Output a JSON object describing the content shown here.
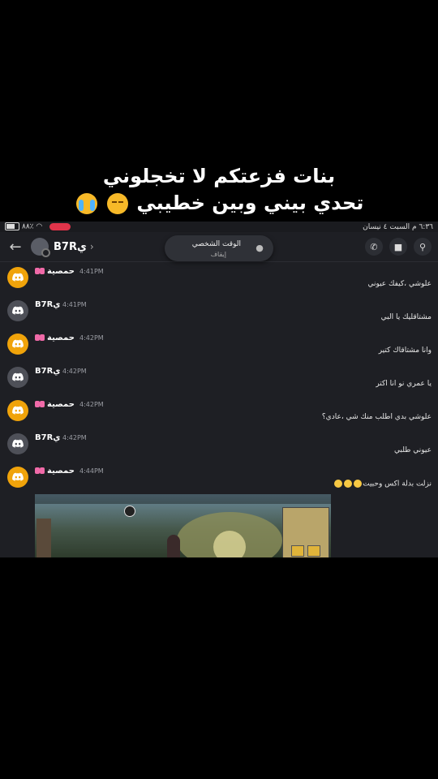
{
  "caption": {
    "line1": "بنات فزعتكم لا تخجلوني",
    "line2": "تحدي بيني وبين خطيبي"
  },
  "status_bar": {
    "time_date": "٦:٣٦ م  السبت ٤ نيسان",
    "battery": "٨٨٪"
  },
  "header": {
    "title": "B7Rي",
    "popup_title": "الوقت الشخصي",
    "popup_subtitle": "إيقاف"
  },
  "icons": {
    "back": "arrow-left-icon",
    "call": "phone-icon",
    "video": "video-icon",
    "search": "search-icon"
  },
  "messages": [
    {
      "author": "حمصية",
      "time": "4:41PM",
      "text": "علوشي ،كيفك عيوني",
      "avatar": "gold",
      "bow": true
    },
    {
      "author": "B7Rي",
      "time": "4:41PM",
      "text": "مشتاقليك يا البي",
      "avatar": "gray",
      "bow": false
    },
    {
      "author": "حمصية",
      "time": "4:42PM",
      "text": "وانا مشتاقاك كتير",
      "avatar": "gold",
      "bow": true
    },
    {
      "author": "B7Rي",
      "time": "4:42PM",
      "text": "يا عمري نو انا اكتر",
      "avatar": "gray",
      "bow": false
    },
    {
      "author": "حمصية",
      "time": "4:42PM",
      "text": "علوشي بدي اطلب منك شي ،عادي؟",
      "avatar": "gold",
      "bow": true
    },
    {
      "author": "B7Rي",
      "time": "4:42PM",
      "text": "عيوني طلبي",
      "avatar": "gray",
      "bow": false
    },
    {
      "author": "حمصية",
      "time": "4:44PM",
      "text": "نزلت بدلة اكس وحبيت",
      "avatar": "gold",
      "bow": true
    }
  ],
  "colors": {
    "app_bg": "#1e1f24",
    "gold_avatar": "#f0a30a",
    "gray_avatar": "#4e5058"
  }
}
